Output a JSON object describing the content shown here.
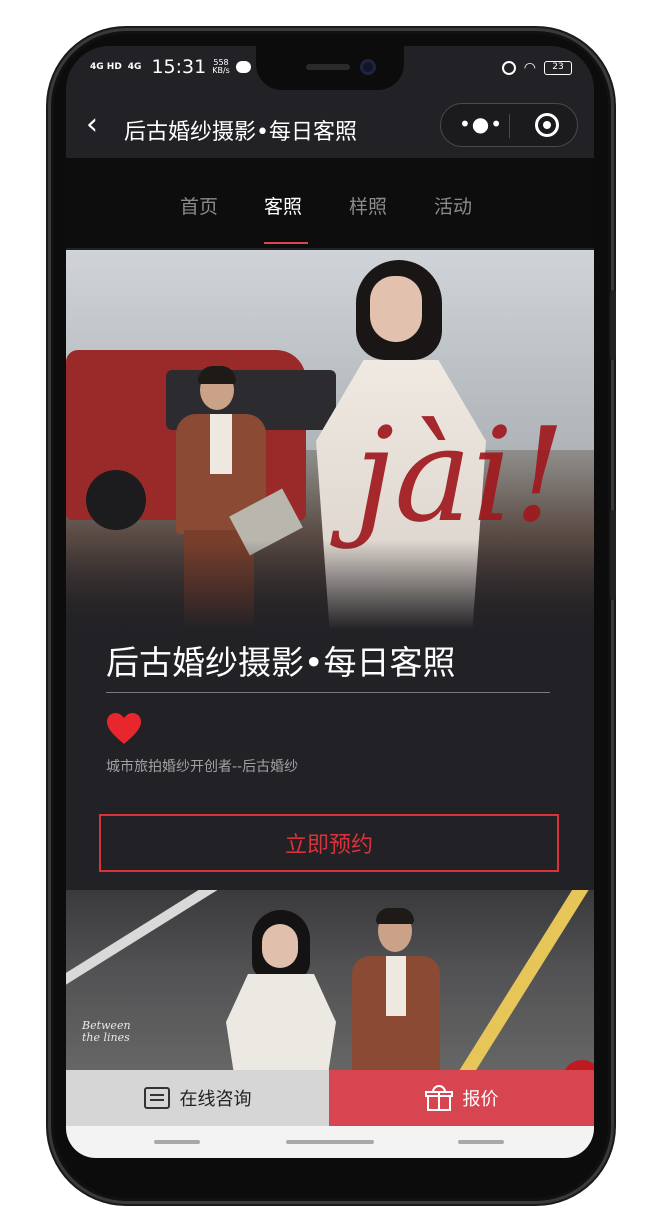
{
  "status_bar": {
    "network1": "4G HD",
    "network2": "4G",
    "time": "15:31",
    "speed_value": "558",
    "speed_unit": "KB/s",
    "battery": "23"
  },
  "nav": {
    "back_icon": "chevron-left-icon",
    "title": "后古婚纱摄影•每日客照",
    "more_icon": "more-dots-icon",
    "close_icon": "target-circle-icon"
  },
  "tabs": [
    {
      "label": "首页",
      "active": false
    },
    {
      "label": "客照",
      "active": true
    },
    {
      "label": "样照",
      "active": false
    },
    {
      "label": "活动",
      "active": false
    }
  ],
  "hero": {
    "overlay_text": "jài!"
  },
  "content": {
    "title": "后古婚纱摄影•每日客照",
    "heart_icon": "heart-icon",
    "subtitle": "城市旅拍婚纱开创者--后古婚纱",
    "book_button": "立即预约"
  },
  "photo2": {
    "caption": "Between the lines"
  },
  "bottom_bar": {
    "consult_label": "在线咨询",
    "consult_icon": "message-icon",
    "quote_label": "报价",
    "quote_icon": "gift-icon"
  },
  "colors": {
    "accent": "#d8323a",
    "quote_bg": "#d64550",
    "page_bg": "#222125"
  }
}
